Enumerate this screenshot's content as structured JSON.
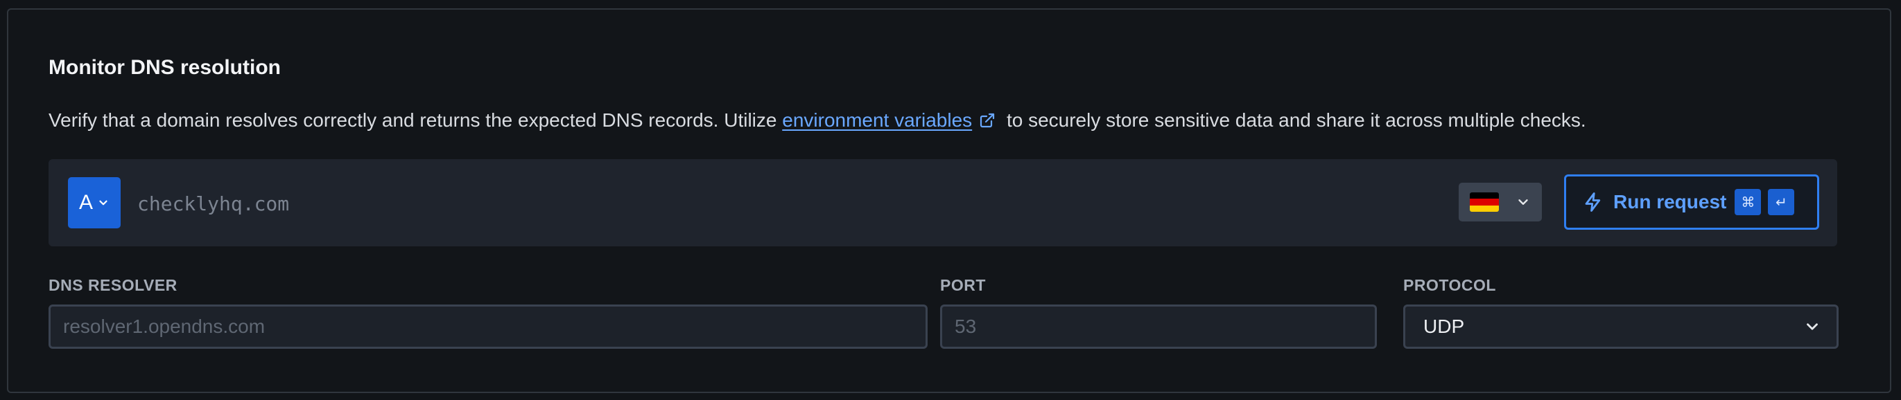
{
  "section": {
    "title": "Monitor DNS resolution",
    "description_before": "Verify that a domain resolves correctly and returns the expected DNS records. Utilize ",
    "description_link": "environment variables",
    "description_after": " to securely store sensitive data and share it across multiple checks."
  },
  "request": {
    "record_type": "A",
    "domain_placeholder": "checklyhq.com",
    "location_flag": "Germany",
    "run_label": "Run request",
    "shortcut_keys": [
      "⌘",
      "↵"
    ]
  },
  "fields": {
    "resolver": {
      "label": "DNS RESOLVER",
      "placeholder": "resolver1.opendns.com"
    },
    "port": {
      "label": "PORT",
      "placeholder": "53"
    },
    "protocol": {
      "label": "PROTOCOL",
      "value": "UDP"
    }
  },
  "colors": {
    "accent": "#2f7ff2",
    "method_bg": "#1a62d8",
    "link": "#6aa8ff",
    "flag": [
      "#000000",
      "#dd0000",
      "#ffce00"
    ]
  }
}
